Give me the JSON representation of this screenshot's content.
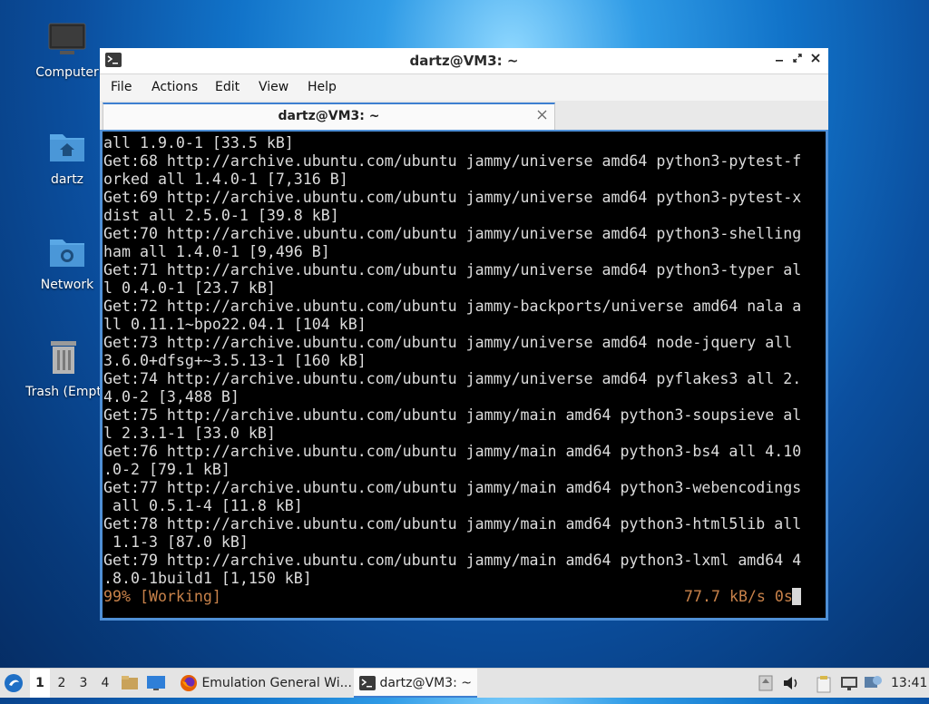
{
  "desktop": {
    "icons": [
      {
        "label": "Computer"
      },
      {
        "label": "dartz"
      },
      {
        "label": "Network"
      },
      {
        "label": "Trash (Empt"
      }
    ]
  },
  "window": {
    "title": "dartz@VM3: ~",
    "menu": [
      "File",
      "Actions",
      "Edit",
      "View",
      "Help"
    ],
    "tab_label": "dartz@VM3: ~",
    "terminal": {
      "lines": [
        "all 1.9.0-1 [33.5 kB]",
        "Get:68 http://archive.ubuntu.com/ubuntu jammy/universe amd64 python3-pytest-f",
        "orked all 1.4.0-1 [7,316 B]",
        "Get:69 http://archive.ubuntu.com/ubuntu jammy/universe amd64 python3-pytest-x",
        "dist all 2.5.0-1 [39.8 kB]",
        "Get:70 http://archive.ubuntu.com/ubuntu jammy/universe amd64 python3-shelling",
        "ham all 1.4.0-1 [9,496 B]",
        "Get:71 http://archive.ubuntu.com/ubuntu jammy/universe amd64 python3-typer al",
        "l 0.4.0-1 [23.7 kB]",
        "Get:72 http://archive.ubuntu.com/ubuntu jammy-backports/universe amd64 nala a",
        "ll 0.11.1~bpo22.04.1 [104 kB]",
        "Get:73 http://archive.ubuntu.com/ubuntu jammy/universe amd64 node-jquery all",
        "3.6.0+dfsg+~3.5.13-1 [160 kB]",
        "Get:74 http://archive.ubuntu.com/ubuntu jammy/universe amd64 pyflakes3 all 2.",
        "4.0-2 [3,488 B]",
        "Get:75 http://archive.ubuntu.com/ubuntu jammy/main amd64 python3-soupsieve al",
        "l 2.3.1-1 [33.0 kB]",
        "Get:76 http://archive.ubuntu.com/ubuntu jammy/main amd64 python3-bs4 all 4.10",
        ".0-2 [79.1 kB]",
        "Get:77 http://archive.ubuntu.com/ubuntu jammy/main amd64 python3-webencodings",
        " all 0.5.1-4 [11.8 kB]",
        "Get:78 http://archive.ubuntu.com/ubuntu jammy/main amd64 python3-html5lib all",
        " 1.1-3 [87.0 kB]",
        "Get:79 http://archive.ubuntu.com/ubuntu jammy/main amd64 python3-lxml amd64 4",
        ".8.0-1build1 [1,150 kB]"
      ],
      "status_left": "99% [Working]",
      "status_right": "77.7 kB/s 0s"
    }
  },
  "taskbar": {
    "workspaces": [
      "1",
      "2",
      "3",
      "4"
    ],
    "tasks": [
      {
        "label": "Emulation General Wi..."
      },
      {
        "label": "dartz@VM3: ~"
      }
    ],
    "clock": "13:41"
  },
  "colors": {
    "accent": "#3d7fd0",
    "status_text": "#c8824a",
    "terminal_bg": "#000000"
  }
}
